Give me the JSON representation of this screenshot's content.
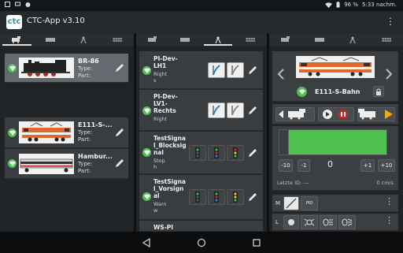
{
  "status": {
    "left_icons": [
      "screen-icon",
      "notification-icon",
      "android-icon"
    ],
    "battery": "96 %",
    "time": "5:33 nachm."
  },
  "app": {
    "logo_text": "ctc",
    "title": "CTC-App v3.10"
  },
  "locos": [
    {
      "name": "BR-86",
      "type_label": "Type:",
      "part_label": "Part:",
      "selected": true
    },
    {
      "name": "E111-S-...",
      "type_label": "Type:",
      "part_label": "Part:",
      "selected": false
    },
    {
      "name": "Hambur...",
      "type_label": "Type:",
      "part_label": "Part:",
      "selected": false
    }
  ],
  "accessories": [
    {
      "name_lines": [
        "PI-Dev-",
        "LH1"
      ],
      "state_lines": [
        "Right",
        "s"
      ],
      "kind": "switch"
    },
    {
      "name_lines": [
        "PI-Dev-",
        "LV1-",
        "Rechts"
      ],
      "state_lines": [
        "Right"
      ],
      "kind": "switch"
    },
    {
      "name_lines": [
        "TestSigna",
        "l_Blocksig",
        "nal"
      ],
      "state_lines": [
        "Stop",
        "h"
      ],
      "kind": "signal"
    },
    {
      "name_lines": [
        "TestSigna",
        "l_Vorsign",
        "al"
      ],
      "state_lines": [
        "Warn",
        "w"
      ],
      "kind": "signal"
    },
    {
      "name_lines": [
        "WS-PI"
      ],
      "state_lines": [],
      "kind": "partial"
    }
  ],
  "control": {
    "loco_name": "E111-S-Bahn",
    "speed_value": "0",
    "speed_percent": 100,
    "buttons": [
      "-10",
      "-1",
      "+1",
      "+10"
    ],
    "last_id_label": "Letzte ID: ---",
    "speed_unit": "0 cm/s",
    "row_labels": [
      "M",
      "L"
    ],
    "pid_label": "PID"
  },
  "colors": {
    "accent_green": "#4fc14f",
    "stop_red": "#d32020",
    "dir_orange": "#f5a800"
  }
}
